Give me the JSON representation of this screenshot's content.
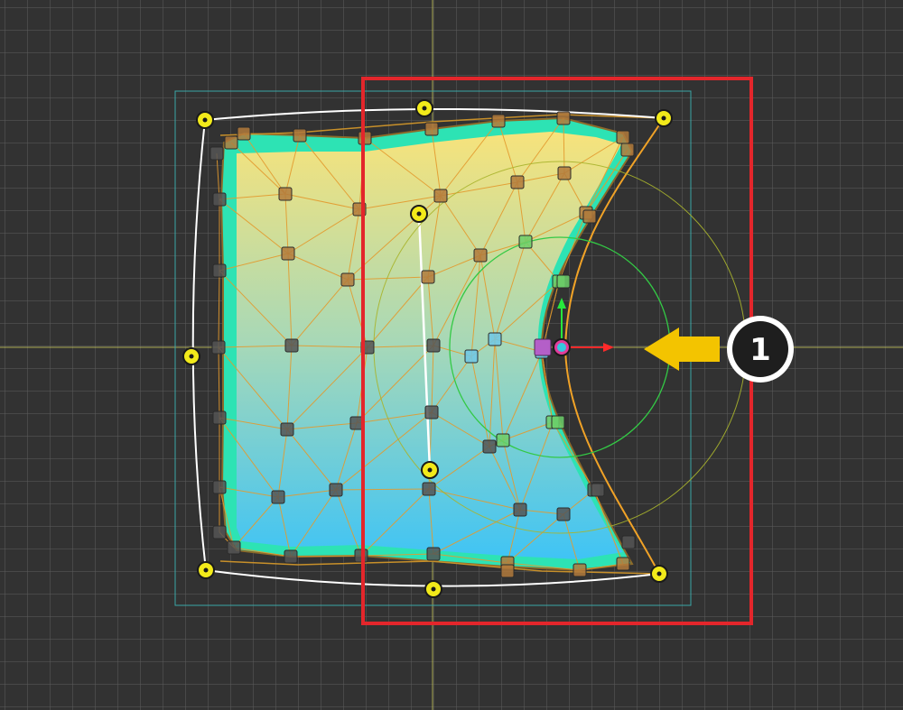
{
  "callout": {
    "label": "1"
  },
  "colors": {
    "background": "#323232",
    "grid_line": "#5a5a5a",
    "crosshair": "#d6d66a",
    "selection_box": "#e3262b",
    "bounds_box": "#3aa7a7",
    "mesh_fill_top": "#f6e07a",
    "mesh_fill_bottom": "#43c6f4",
    "mesh_edge_glow": "#2de3b4",
    "mesh_edge_line": "#e8a33a",
    "deform_curve": "#ffffff",
    "control_point": "#f2ea1a",
    "brush_inner": "#3ccf4a",
    "brush_outer": "#b5c22f",
    "gizmo_x": "#ff2a2a",
    "gizmo_y": "#27e83c",
    "gizmo_center": "#e23c9b",
    "arrow": "#f3c400",
    "callout_badge": "#1e1e1e"
  },
  "icons": {
    "control_point": "control-point-icon",
    "gizmo": "move-gizmo-icon",
    "arrow": "arrow-left-icon",
    "badge": "number-badge-icon"
  }
}
